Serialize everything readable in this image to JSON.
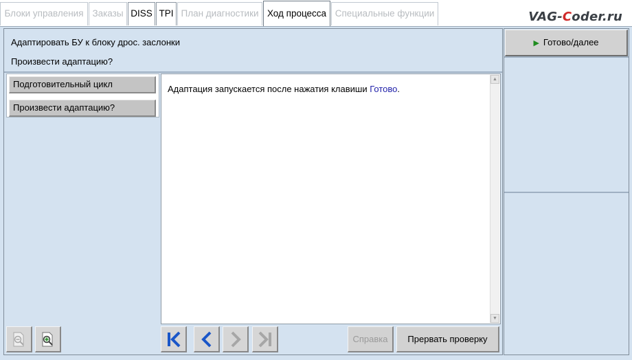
{
  "tabs": [
    {
      "label": "Блоки управления",
      "state": "disabled"
    },
    {
      "label": "Заказы",
      "state": "disabled"
    },
    {
      "label": "DISS",
      "state": "enabled"
    },
    {
      "label": "TPI",
      "state": "enabled"
    },
    {
      "label": "План диагностики",
      "state": "disabled"
    },
    {
      "label": "Ход процесса",
      "state": "active"
    },
    {
      "label": "Специальные функции",
      "state": "disabled"
    }
  ],
  "watermark": {
    "part1": "VAG-",
    "part2": "C",
    "part3": "oder.ru"
  },
  "header": {
    "line1": "Адаптировать БУ к блоку дрос. заслонки",
    "line2": "Произвести адаптацию?"
  },
  "steps": [
    {
      "label": "Подготовительный цикл"
    },
    {
      "label": "Произвести адаптацию?"
    }
  ],
  "content": {
    "text_before": "Адаптация запускается после нажатия клавиши ",
    "link": "Готово",
    "text_after": "."
  },
  "buttons": {
    "ready_next": "Готово/далее",
    "help": "Справка",
    "abort": "Прервать проверку"
  },
  "icons": {
    "zoom_out": "zoom-out-icon",
    "zoom_in": "zoom-in-icon",
    "first": "first-page-icon",
    "prev": "prev-icon",
    "next": "next-icon",
    "last": "last-page-icon"
  },
  "colors": {
    "accent_blue": "#1a56c8",
    "link_blue": "#2222aa",
    "play_green": "#1f8c1f"
  }
}
